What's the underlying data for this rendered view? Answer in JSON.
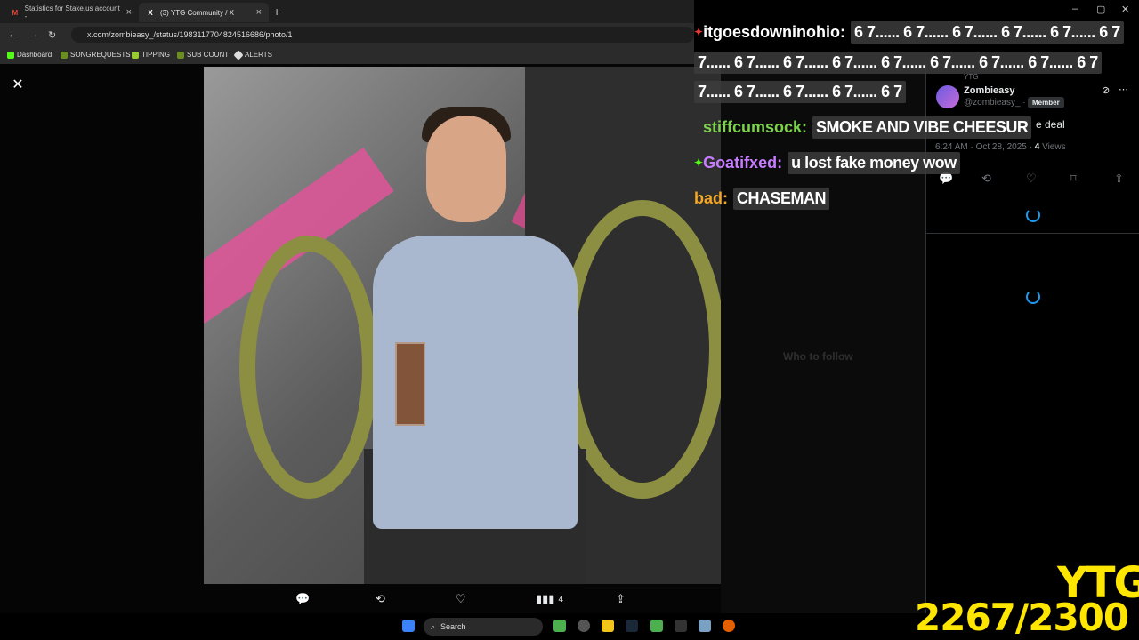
{
  "browser": {
    "tabs": [
      {
        "title": "Statistics for Stake.us account -",
        "favicon": "gmail-icon"
      },
      {
        "title": "(3) YTG Community / X",
        "favicon": "x-icon"
      }
    ],
    "url": "x.com/zombieasy_/status/1983117704824516686/photo/1",
    "bookmarks": [
      "Dashboard",
      "SONGREQUESTS",
      "TIPPING",
      "SUB COUNT",
      "ALERTS"
    ]
  },
  "viewer": {
    "actions": {
      "views": "4"
    }
  },
  "chat": [
    {
      "user": "itgoesdowninohio:",
      "user_color": "#ffffff",
      "message": "6 7...... 6 7...... 6 7...... 6 7...... 6 7...... 6 7"
    },
    {
      "user": "",
      "message": "7...... 6 7...... 6 7...... 6 7...... 6 7...... 6 7...... 6 7...... 6 7...... 6 7"
    },
    {
      "user": "",
      "message": "7...... 6 7...... 6 7...... 6 7...... 6 7"
    },
    {
      "user": "stiffcumsock:",
      "user_color": "#7bd34a",
      "message": "SMOKE AND VIBE CHEESUR"
    },
    {
      "user": "Goatifxed:",
      "user_color": "#c77dff",
      "message": "u lost fake money wow"
    },
    {
      "user": "bad:",
      "user_color": "#f5a623",
      "message": "CHASEMAN"
    }
  ],
  "panel": {
    "community": "YTG",
    "name": "Zombieasy",
    "handle": "@zombieasy_ ·",
    "badge": "Member",
    "text": "e deal",
    "time": "6:24 AM · Oct 28, 2025 ·",
    "views_count": "4",
    "views_label": "Views"
  },
  "overlay": {
    "brand": "YTG",
    "counter": "2267/2300"
  },
  "taskbar": {
    "search": "Search"
  },
  "colors": {
    "accent": "#1d9bf0",
    "overlay": "#ffe600"
  }
}
